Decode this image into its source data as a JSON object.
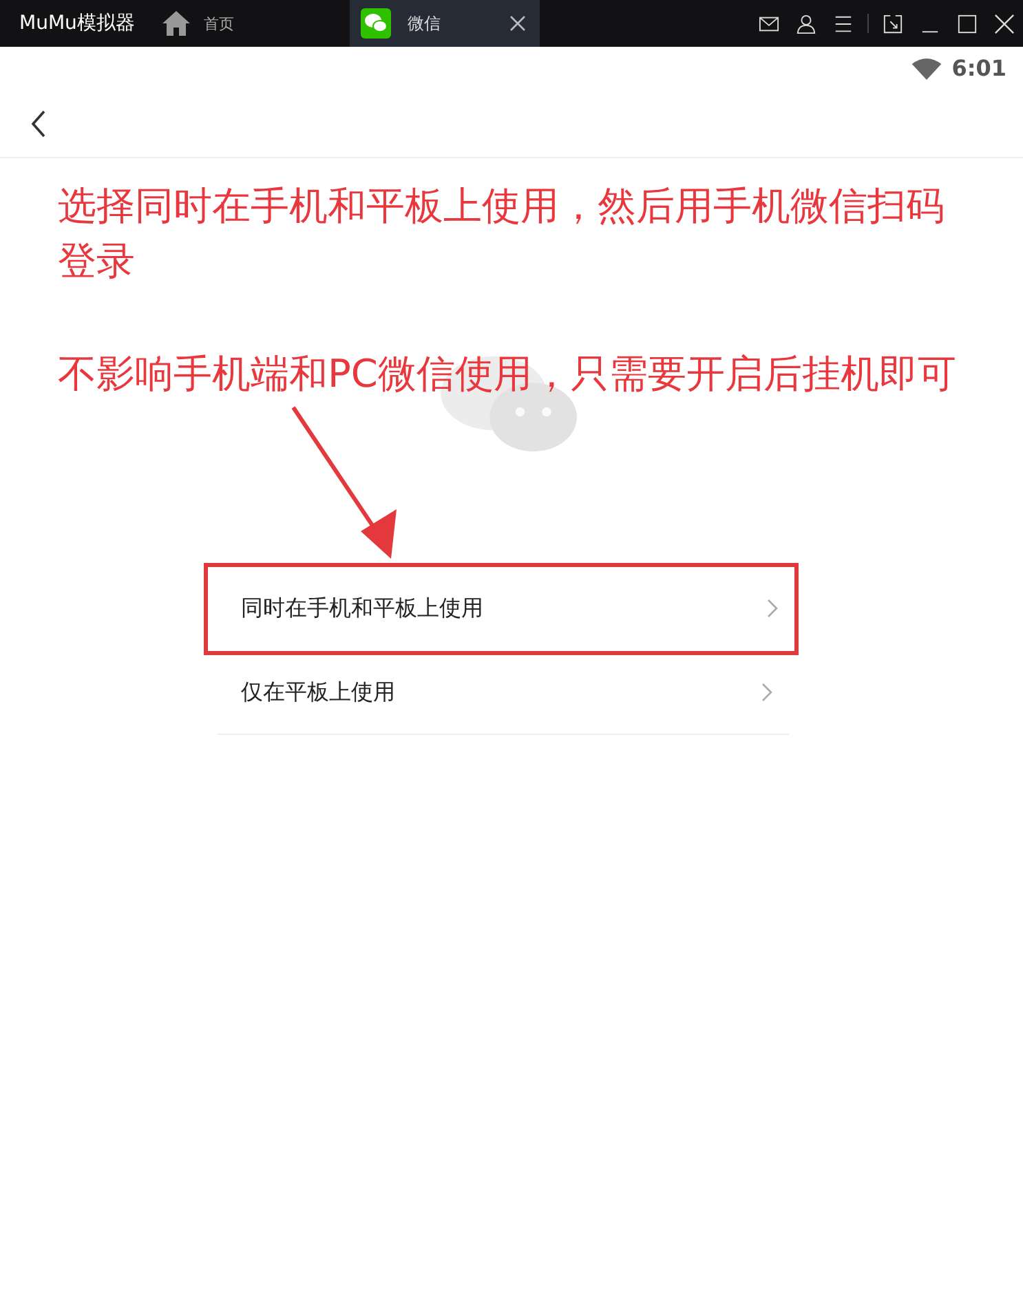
{
  "window": {
    "app_title": "MuMu模拟器",
    "tabs": [
      {
        "label": "首页",
        "selected": false,
        "kind": "home",
        "closable": false
      },
      {
        "label": "微信",
        "selected": true,
        "kind": "app",
        "closable": true
      }
    ]
  },
  "status_bar": {
    "time": "6:01"
  },
  "annotations": [
    "选择同时在手机和平板上使用，然后用手机微信扫码登录",
    "不影响手机端和PC微信使用，只需要开启后挂机即可"
  ],
  "options": [
    {
      "label": "同时在手机和平板上使用",
      "highlighted": true
    },
    {
      "label": "仅在平板上使用",
      "highlighted": false
    }
  ]
}
